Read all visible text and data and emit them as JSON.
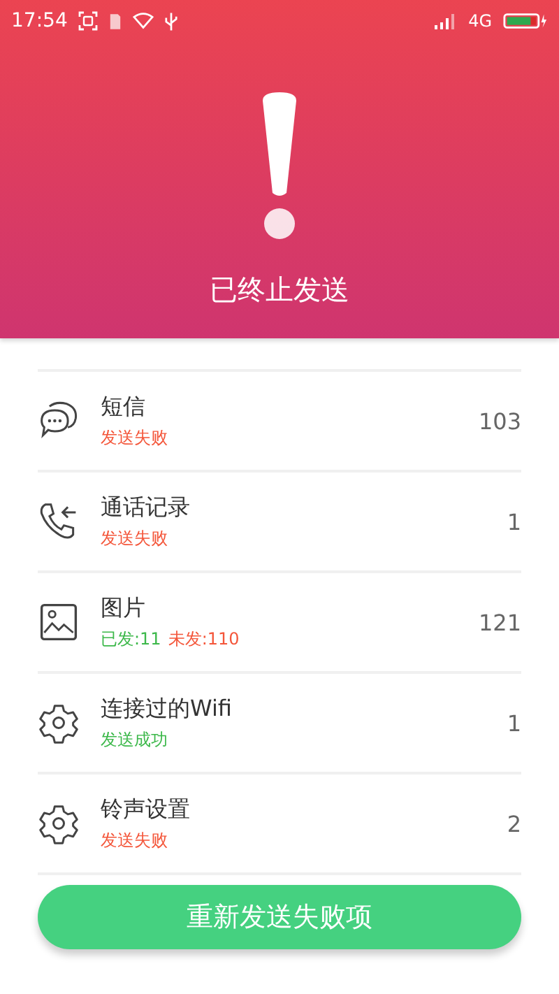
{
  "status_bar": {
    "time": "17:54",
    "network": "4G"
  },
  "header": {
    "title": "已终止发送"
  },
  "items": [
    {
      "kind": "chat",
      "name": "短信",
      "count": "103",
      "status": [
        {
          "text": "发送失败",
          "kind": "fail"
        }
      ]
    },
    {
      "kind": "call",
      "name": "通话记录",
      "count": "1",
      "status": [
        {
          "text": "发送失败",
          "kind": "fail"
        }
      ]
    },
    {
      "kind": "image",
      "name": "图片",
      "count": "121",
      "status": [
        {
          "text": "已发:11",
          "kind": "ok"
        },
        {
          "text": "未发:110",
          "kind": "fail"
        }
      ]
    },
    {
      "kind": "setting",
      "name": "连接过的Wifi",
      "count": "1",
      "status": [
        {
          "text": "发送成功",
          "kind": "ok"
        }
      ]
    },
    {
      "kind": "setting",
      "name": "铃声设置",
      "count": "2",
      "status": [
        {
          "text": "发送失败",
          "kind": "fail"
        }
      ]
    }
  ],
  "button": {
    "label": "重新发送失败项"
  }
}
